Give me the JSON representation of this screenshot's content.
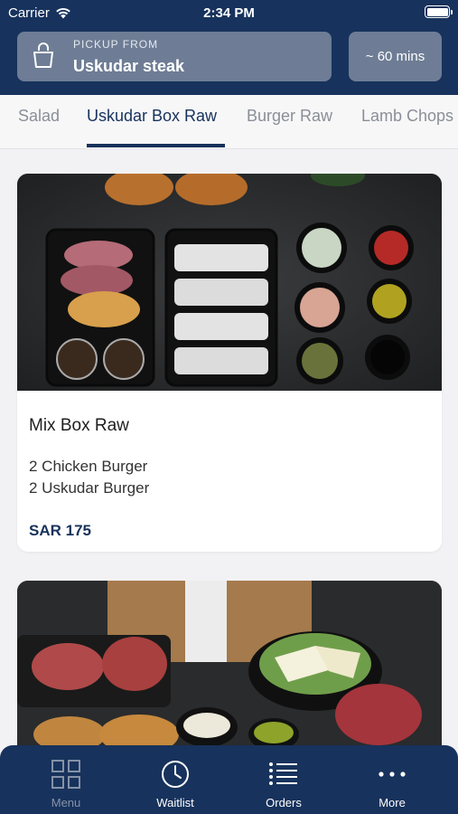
{
  "status_bar": {
    "carrier": "Carrier",
    "time": "2:34 PM"
  },
  "header": {
    "pickup_label": "PICKUP FROM",
    "pickup_location": "Uskudar steak",
    "eta": "~ 60 mins"
  },
  "category_tabs": [
    {
      "label": "Salad",
      "active": false
    },
    {
      "label": "Uskudar Box Raw",
      "active": true
    },
    {
      "label": "Burger Raw",
      "active": false
    },
    {
      "label": "Lamb Chops",
      "active": false
    }
  ],
  "products": [
    {
      "title": "Mix Box Raw",
      "description_lines": [
        "2 Chicken Burger",
        "2 Uskudar Burger"
      ],
      "price": "SAR 175"
    },
    {
      "title": "",
      "description_lines": [],
      "price": ""
    }
  ],
  "bottom_nav": [
    {
      "label": "Menu",
      "icon": "grid-icon"
    },
    {
      "label": "Waitlist",
      "icon": "clock-icon"
    },
    {
      "label": "Orders",
      "icon": "list-icon"
    },
    {
      "label": "More",
      "icon": "more-dots-icon"
    }
  ],
  "colors": {
    "brand_navy": "#17325c",
    "pill_gray": "#6e7d95",
    "background": "#f2f2f4"
  }
}
